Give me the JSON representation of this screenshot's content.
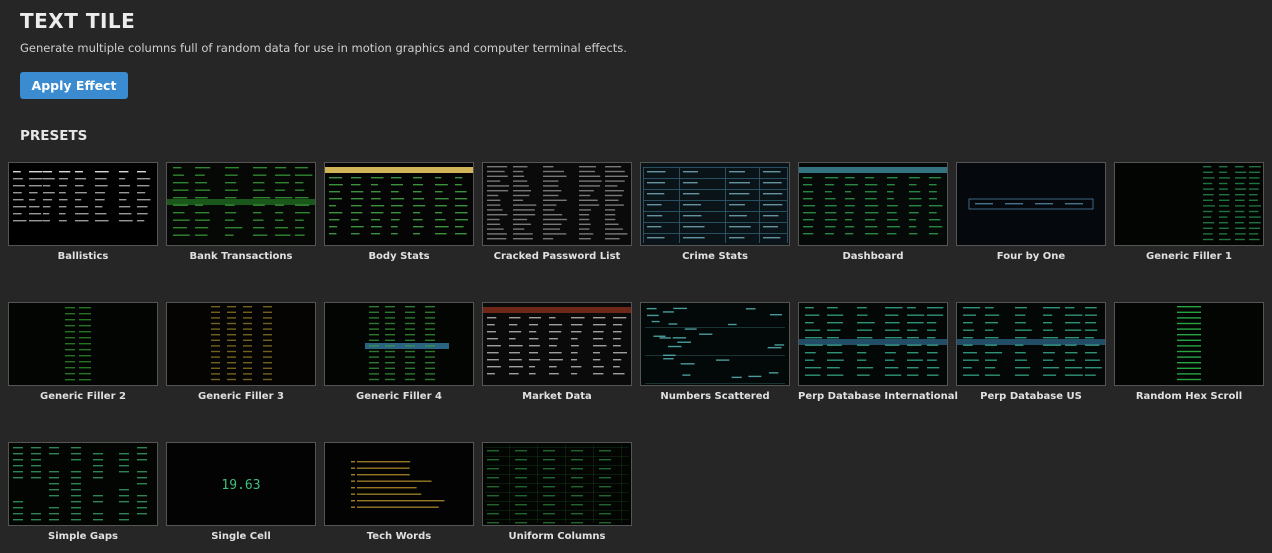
{
  "header": {
    "title": "TEXT TILE",
    "description": "Generate multiple columns full of random data for use in motion graphics and computer terminal effects.",
    "apply_label": "Apply Effect",
    "presets_heading": "PRESETS"
  },
  "presets": [
    {
      "label": "Ballistics",
      "thumb": {
        "style": "table",
        "fg": "#d8d8d8",
        "bg": "#000000"
      }
    },
    {
      "label": "Bank Transactions",
      "thumb": {
        "style": "rows-highlight",
        "fg": "#3fae3f",
        "bg": "#050805",
        "hl": "#1f6b1f"
      }
    },
    {
      "label": "Body Stats",
      "thumb": {
        "style": "header-table",
        "fg": "#4fc04f",
        "bg": "#050505",
        "hl": "#e8c860"
      }
    },
    {
      "label": "Cracked Password List",
      "thumb": {
        "style": "dense-table",
        "fg": "#bfbfbf",
        "bg": "#0a0a0a"
      }
    },
    {
      "label": "Crime Stats",
      "thumb": {
        "style": "grid-table",
        "fg": "#8cc8d8",
        "bg": "#0a1418",
        "hl": "#2f5f73"
      }
    },
    {
      "label": "Dashboard",
      "thumb": {
        "style": "header-table",
        "fg": "#35b055",
        "bg": "#050a08",
        "hl": "#3a7f8f"
      }
    },
    {
      "label": "Four by One",
      "thumb": {
        "style": "single-row",
        "fg": "#4f7fa0",
        "bg": "#05080c"
      }
    },
    {
      "label": "Generic Filler 1",
      "thumb": {
        "style": "columns-right",
        "fg": "#2f9f5f",
        "bg": "#030503"
      }
    },
    {
      "label": "Generic Filler 2",
      "thumb": {
        "style": "center-column",
        "fg": "#2f8f2f",
        "bg": "#030503"
      }
    },
    {
      "label": "Generic Filler 3",
      "thumb": {
        "style": "center-columns",
        "fg": "#a08a30",
        "bg": "#050403"
      }
    },
    {
      "label": "Generic Filler 4",
      "thumb": {
        "style": "center-highlight",
        "fg": "#3f9f3f",
        "bg": "#030503",
        "hl": "#2f6f8f"
      }
    },
    {
      "label": "Market Data",
      "thumb": {
        "style": "header-table",
        "fg": "#d0d0d0",
        "bg": "#0a0a0a",
        "hl": "#7a2a1a"
      }
    },
    {
      "label": "Numbers Scattered",
      "thumb": {
        "style": "scattered",
        "fg": "#5fbfbf",
        "bg": "#030808"
      }
    },
    {
      "label": "Perp Database International",
      "thumb": {
        "style": "rows-highlight",
        "fg": "#3fbf9f",
        "bg": "#030806",
        "hl": "#2a5f7f"
      }
    },
    {
      "label": "Perp Database US",
      "thumb": {
        "style": "rows-highlight",
        "fg": "#3fbf9f",
        "bg": "#030806",
        "hl": "#2a5f7f"
      }
    },
    {
      "label": "Random Hex Scroll",
      "thumb": {
        "style": "hex-column",
        "fg": "#2fbf4f",
        "bg": "#030503"
      }
    },
    {
      "label": "Simple Gaps",
      "thumb": {
        "style": "gaps",
        "fg": "#3faf6f",
        "bg": "#030503"
      }
    },
    {
      "label": "Single Cell",
      "thumb": {
        "style": "single-cell",
        "fg": "#3fbf7f",
        "bg": "#030303",
        "value": "19.63"
      }
    },
    {
      "label": "Tech Words",
      "thumb": {
        "style": "words",
        "fg": "#c8a030",
        "bg": "#030303"
      }
    },
    {
      "label": "Uniform Columns",
      "thumb": {
        "style": "uniform",
        "fg": "#2f8f3f",
        "bg": "#030503"
      }
    }
  ]
}
